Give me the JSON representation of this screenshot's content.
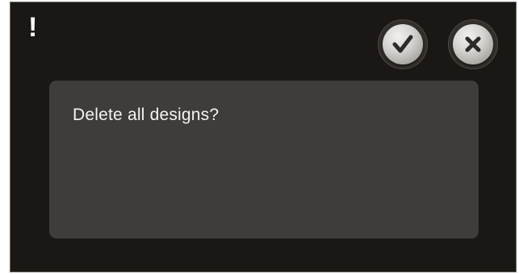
{
  "dialog": {
    "alert_symbol": "!",
    "message": "Delete all designs?",
    "confirm_icon": "checkmark-icon",
    "cancel_icon": "close-icon"
  },
  "colors": {
    "background": "#1b1714",
    "panel": "#403c3a",
    "text": "#f4f4f4",
    "button_face": "#d6d4d1",
    "icon": "#2e2a27"
  }
}
